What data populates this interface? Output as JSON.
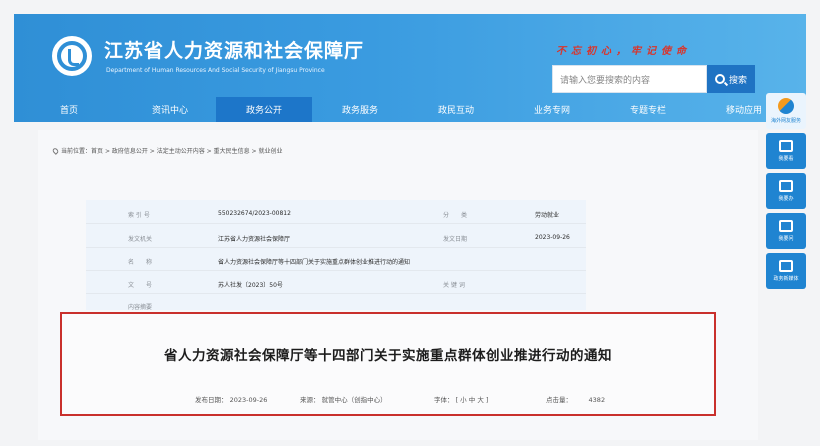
{
  "header": {
    "site_title": "江苏省人力资源和社会保障厅",
    "site_subtitle": "Department of Human Resources And Social Security of Jiangsu Province",
    "slogan": "不忘初心，牢记使命",
    "search": {
      "placeholder": "请输入您要搜索的内容",
      "button_label": "搜索"
    }
  },
  "nav": {
    "items": [
      "首页",
      "资讯中心",
      "政务公开",
      "政务服务",
      "政民互动",
      "业务专网",
      "专题专栏",
      "移动应用"
    ],
    "active_index": 2
  },
  "sidebar": {
    "items": [
      "海外网友服务",
      "我要看",
      "我要办",
      "我要问",
      "政务新媒体"
    ]
  },
  "breadcrumb": {
    "label": "当前位置：",
    "items": [
      "首页",
      "政府信息公开",
      "法定主动公开内容",
      "重大民生信息",
      "就业创业"
    ],
    "separator": " > "
  },
  "info": {
    "index_label": "索 引 号",
    "index_value": "550232674/2023-00812",
    "category_label": "分　　类",
    "category_value": "劳动就业",
    "issuer_label": "发文机关",
    "issuer_value": "江苏省人力资源社会保障厅",
    "date_label": "发文日期",
    "date_value": "2023-09-26",
    "name_label": "名　　称",
    "name_value": "省人力资源社会保障厅等十四部门关于实施重点群体创业推进行动的通知",
    "docno_label": "文　　号",
    "docno_value": "苏人社发〔2023〕50号",
    "keyword_label": "关 键 词",
    "summary_label": "内容摘要"
  },
  "document": {
    "title": "省人力资源社会保障厅等十四部门关于实施重点群体创业推进行动的通知",
    "publish_label": "发布日期：",
    "publish_date": "2023-09-26",
    "source_label": "来源：",
    "source_value": "就管中心（创指中心）",
    "font_label": "字体：",
    "font_options": "[ 小 中 大 ]",
    "views_label": "点击量：",
    "views_value": "4382"
  },
  "colors": {
    "header_blue": "#2f8fd6",
    "nav_active": "#1d76c9",
    "highlight_border": "#c9302c",
    "slogan_red": "#d9342b"
  }
}
